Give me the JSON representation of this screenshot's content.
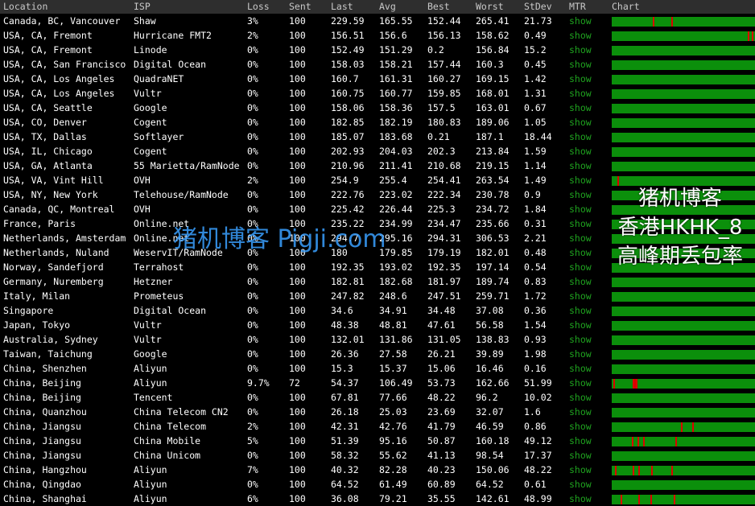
{
  "header": {
    "location": "Location",
    "isp": "ISP",
    "loss": "Loss",
    "sent": "Sent",
    "last": "Last",
    "avg": "Avg",
    "best": "Best",
    "worst": "Worst",
    "stdev": "StDev",
    "mtr": "MTR",
    "chart": "Chart"
  },
  "rows": [
    {
      "location": "Canada, BC, Vancouver",
      "isp": "Shaw",
      "loss": "3%",
      "sent": "100",
      "last": "229.59",
      "avg": "165.55",
      "best": "152.44",
      "worst": "265.41",
      "stdev": "21.73",
      "mtr": "show",
      "spikes": [
        0.29,
        0.42
      ]
    },
    {
      "location": "USA, CA, Fremont",
      "isp": "Hurricane FMT2",
      "loss": "2%",
      "sent": "100",
      "last": "156.51",
      "avg": "156.6",
      "best": "156.13",
      "worst": "158.62",
      "stdev": "0.49",
      "mtr": "show",
      "spikes": [
        0.96,
        0.99
      ]
    },
    {
      "location": "USA, CA, Fremont",
      "isp": "Linode",
      "loss": "0%",
      "sent": "100",
      "last": "152.49",
      "avg": "151.29",
      "best": "0.2",
      "worst": "156.84",
      "stdev": "15.2",
      "mtr": "show",
      "spikes": []
    },
    {
      "location": "USA, CA, San Francisco",
      "isp": "Digital Ocean",
      "loss": "0%",
      "sent": "100",
      "last": "158.03",
      "avg": "158.21",
      "best": "157.44",
      "worst": "160.3",
      "stdev": "0.45",
      "mtr": "show",
      "spikes": []
    },
    {
      "location": "USA, CA, Los Angeles",
      "isp": "QuadraNET",
      "loss": "0%",
      "sent": "100",
      "last": "160.7",
      "avg": "161.31",
      "best": "160.27",
      "worst": "169.15",
      "stdev": "1.42",
      "mtr": "show",
      "spikes": []
    },
    {
      "location": "USA, CA, Los Angeles",
      "isp": "Vultr",
      "loss": "0%",
      "sent": "100",
      "last": "160.75",
      "avg": "160.77",
      "best": "159.85",
      "worst": "168.01",
      "stdev": "1.31",
      "mtr": "show",
      "spikes": []
    },
    {
      "location": "USA, CA, Seattle",
      "isp": "Google",
      "loss": "0%",
      "sent": "100",
      "last": "158.06",
      "avg": "158.36",
      "best": "157.5",
      "worst": "163.01",
      "stdev": "0.67",
      "mtr": "show",
      "spikes": []
    },
    {
      "location": "USA, CO, Denver",
      "isp": "Cogent",
      "loss": "0%",
      "sent": "100",
      "last": "182.85",
      "avg": "182.19",
      "best": "180.83",
      "worst": "189.06",
      "stdev": "1.05",
      "mtr": "show",
      "spikes": []
    },
    {
      "location": "USA, TX, Dallas",
      "isp": "Softlayer",
      "loss": "0%",
      "sent": "100",
      "last": "185.07",
      "avg": "183.68",
      "best": "0.21",
      "worst": "187.1",
      "stdev": "18.44",
      "mtr": "show",
      "spikes": []
    },
    {
      "location": "USA, IL, Chicago",
      "isp": "Cogent",
      "loss": "0%",
      "sent": "100",
      "last": "202.93",
      "avg": "204.03",
      "best": "202.3",
      "worst": "213.84",
      "stdev": "1.59",
      "mtr": "show",
      "spikes": []
    },
    {
      "location": "USA, GA, Atlanta",
      "isp": "55 Marietta/RamNode",
      "loss": "0%",
      "sent": "100",
      "last": "210.96",
      "avg": "211.41",
      "best": "210.68",
      "worst": "219.15",
      "stdev": "1.14",
      "mtr": "show",
      "spikes": []
    },
    {
      "location": "USA, VA, Vint Hill",
      "isp": "OVH",
      "loss": "2%",
      "sent": "100",
      "last": "254.9",
      "avg": "255.4",
      "best": "254.41",
      "worst": "263.54",
      "stdev": "1.49",
      "mtr": "show",
      "spikes": [
        0.04
      ]
    },
    {
      "location": "USA, NY, New York",
      "isp": "Telehouse/RamNode",
      "loss": "0%",
      "sent": "100",
      "last": "222.76",
      "avg": "223.02",
      "best": "222.34",
      "worst": "230.78",
      "stdev": "0.9",
      "mtr": "show",
      "spikes": []
    },
    {
      "location": "Canada, QC, Montreal",
      "isp": "OVH",
      "loss": "0%",
      "sent": "100",
      "last": "225.42",
      "avg": "226.44",
      "best": "225.3",
      "worst": "234.72",
      "stdev": "1.84",
      "mtr": "show",
      "spikes": []
    },
    {
      "location": "France, Paris",
      "isp": "Online.net",
      "loss": "0%",
      "sent": "100",
      "last": "235.22",
      "avg": "234.99",
      "best": "234.47",
      "worst": "235.66",
      "stdev": "0.31",
      "mtr": "show",
      "spikes": []
    },
    {
      "location": "Netherlands, Amsterdam",
      "isp": "Online.net",
      "loss": "0%",
      "sent": "100",
      "last": "294.7",
      "avg": "295.16",
      "best": "294.31",
      "worst": "306.53",
      "stdev": "2.21",
      "mtr": "show",
      "spikes": []
    },
    {
      "location": "Netherlands, Nuland",
      "isp": "WeservIT/RamNode",
      "loss": "0%",
      "sent": "100",
      "last": "180",
      "avg": "179.85",
      "best": "179.19",
      "worst": "182.01",
      "stdev": "0.48",
      "mtr": "show",
      "spikes": []
    },
    {
      "location": "Norway, Sandefjord",
      "isp": "Terrahost",
      "loss": "0%",
      "sent": "100",
      "last": "192.35",
      "avg": "193.02",
      "best": "192.35",
      "worst": "197.14",
      "stdev": "0.54",
      "mtr": "show",
      "spikes": []
    },
    {
      "location": "Germany, Nuremberg",
      "isp": "Hetzner",
      "loss": "0%",
      "sent": "100",
      "last": "182.81",
      "avg": "182.68",
      "best": "181.97",
      "worst": "189.74",
      "stdev": "0.83",
      "mtr": "show",
      "spikes": []
    },
    {
      "location": "Italy, Milan",
      "isp": "Prometeus",
      "loss": "0%",
      "sent": "100",
      "last": "247.82",
      "avg": "248.6",
      "best": "247.51",
      "worst": "259.71",
      "stdev": "1.72",
      "mtr": "show",
      "spikes": []
    },
    {
      "location": "Singapore",
      "isp": "Digital Ocean",
      "loss": "0%",
      "sent": "100",
      "last": "34.6",
      "avg": "34.91",
      "best": "34.48",
      "worst": "37.08",
      "stdev": "0.36",
      "mtr": "show",
      "spikes": []
    },
    {
      "location": "Japan, Tokyo",
      "isp": "Vultr",
      "loss": "0%",
      "sent": "100",
      "last": "48.38",
      "avg": "48.81",
      "best": "47.61",
      "worst": "56.58",
      "stdev": "1.54",
      "mtr": "show",
      "spikes": []
    },
    {
      "location": "Australia, Sydney",
      "isp": "Vultr",
      "loss": "0%",
      "sent": "100",
      "last": "132.01",
      "avg": "131.86",
      "best": "131.05",
      "worst": "138.83",
      "stdev": "0.93",
      "mtr": "show",
      "spikes": []
    },
    {
      "location": "Taiwan, Taichung",
      "isp": "Google",
      "loss": "0%",
      "sent": "100",
      "last": "26.36",
      "avg": "27.58",
      "best": "26.21",
      "worst": "39.89",
      "stdev": "1.98",
      "mtr": "show",
      "spikes": []
    },
    {
      "location": "China, Shenzhen",
      "isp": "Aliyun",
      "loss": "0%",
      "sent": "100",
      "last": "15.3",
      "avg": "15.37",
      "best": "15.06",
      "worst": "16.46",
      "stdev": "0.16",
      "mtr": "show",
      "spikes": []
    },
    {
      "location": "China, Beijing",
      "isp": "Aliyun",
      "loss": "9.7%",
      "sent": "72",
      "last": "54.37",
      "avg": "106.49",
      "best": "53.73",
      "worst": "162.66",
      "stdev": "51.99",
      "mtr": "show",
      "spikes": [
        0.01,
        0.15,
        0.16,
        0.17
      ]
    },
    {
      "location": "China, Beijing",
      "isp": "Tencent",
      "loss": "0%",
      "sent": "100",
      "last": "67.81",
      "avg": "77.66",
      "best": "48.22",
      "worst": "96.2",
      "stdev": "10.02",
      "mtr": "show",
      "spikes": []
    },
    {
      "location": "China, Quanzhou",
      "isp": "China Telecom CN2",
      "loss": "0%",
      "sent": "100",
      "last": "26.18",
      "avg": "25.03",
      "best": "23.69",
      "worst": "32.07",
      "stdev": "1.6",
      "mtr": "show",
      "spikes": []
    },
    {
      "location": "China, Jiangsu",
      "isp": "China Telecom",
      "loss": "2%",
      "sent": "100",
      "last": "42.31",
      "avg": "42.76",
      "best": "41.79",
      "worst": "46.59",
      "stdev": "0.86",
      "mtr": "show",
      "spikes": [
        0.49,
        0.57
      ]
    },
    {
      "location": "China, Jiangsu",
      "isp": "China Mobile",
      "loss": "5%",
      "sent": "100",
      "last": "51.39",
      "avg": "95.16",
      "best": "50.87",
      "worst": "160.18",
      "stdev": "49.12",
      "mtr": "show",
      "spikes": [
        0.14,
        0.18,
        0.22,
        0.45
      ]
    },
    {
      "location": "China, Jiangsu",
      "isp": "China Unicom",
      "loss": "0%",
      "sent": "100",
      "last": "58.32",
      "avg": "55.62",
      "best": "41.13",
      "worst": "98.54",
      "stdev": "17.37",
      "mtr": "show",
      "spikes": []
    },
    {
      "location": "China, Hangzhou",
      "isp": "Aliyun",
      "loss": "7%",
      "sent": "100",
      "last": "40.32",
      "avg": "82.28",
      "best": "40.23",
      "worst": "150.06",
      "stdev": "48.22",
      "mtr": "show",
      "spikes": [
        0.02,
        0.15,
        0.19,
        0.28,
        0.42
      ]
    },
    {
      "location": "China, Qingdao",
      "isp": "Aliyun",
      "loss": "0%",
      "sent": "100",
      "last": "64.52",
      "avg": "61.49",
      "best": "60.89",
      "worst": "64.52",
      "stdev": "0.61",
      "mtr": "show",
      "spikes": []
    },
    {
      "location": "China, Shanghai",
      "isp": "Aliyun",
      "loss": "6%",
      "sent": "100",
      "last": "36.08",
      "avg": "79.21",
      "best": "35.55",
      "worst": "142.61",
      "stdev": "48.99",
      "mtr": "show",
      "spikes": [
        0.06,
        0.19,
        0.27,
        0.44
      ]
    }
  ],
  "overlay": {
    "line1": "猪机博客",
    "line2": "香港HKHK_8",
    "line3": "高峰期丢包率",
    "watermark": "猪机博客 Pigji.com"
  },
  "colors": {
    "bar": "#0b8f0b",
    "loss_spike": "#dd0000",
    "mtr_link": "#1fa31f",
    "header_bg": "#2e2e2e"
  }
}
